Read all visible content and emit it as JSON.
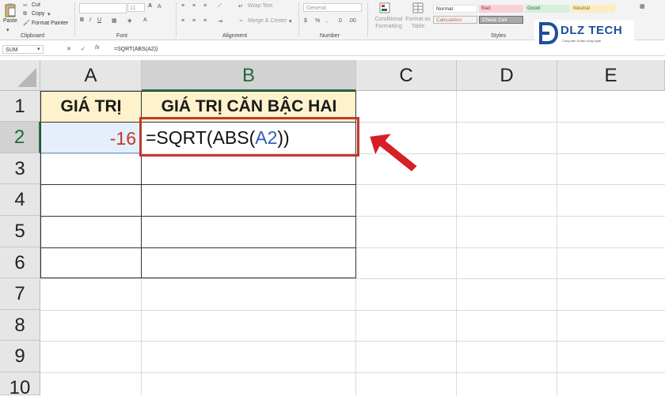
{
  "ribbon": {
    "clipboard": {
      "paste": "Paste",
      "cut": "Cut",
      "copy": "Copy",
      "format_painter": "Format Painter",
      "label": "Clipboard"
    },
    "font": {
      "label": "Font",
      "size": "11"
    },
    "alignment": {
      "wrap_text": "Wrap Text",
      "merge_center": "Merge & Center",
      "label": "Alignment"
    },
    "number": {
      "format": "General",
      "label": "Number"
    },
    "styles": {
      "conditional_formatting": "Conditional Formatting",
      "format_as_table": "Format as Table",
      "normal": "Normal",
      "bad": "Bad",
      "good": "Good",
      "neutral": "Neutral",
      "calculation": "Calculation",
      "check_cell": "Check Cell",
      "label": "Styles"
    }
  },
  "watermark": {
    "brand": "DLZ TECH",
    "tagline": "Cùng bạn đi đầu công nghệ"
  },
  "formula_bar": {
    "name_box": "SUM",
    "formula": "=SQRT(ABS(A2))",
    "cancel": "✕",
    "enter": "✓",
    "fx": "fx"
  },
  "columns": [
    "A",
    "B",
    "C",
    "D",
    "E"
  ],
  "rows": [
    "1",
    "2",
    "3",
    "4",
    "5",
    "6",
    "7",
    "8",
    "9",
    "10"
  ],
  "cells": {
    "a1": "GIÁ TRỊ",
    "b1": "GIÁ TRỊ CĂN BẬC HAI",
    "a2": "-16",
    "b2_prefix": "=SQRT(ABS(",
    "b2_ref": "A2",
    "b2_suffix": "))"
  },
  "colors": {
    "accent": "#217346",
    "ref_blue": "#2f5fb3",
    "ref_red": "#c0392b",
    "arrow": "#d61f26",
    "header_fill": "#fdf2cc",
    "ref_fill": "#e5eefb",
    "formula_border": "#c0392b"
  }
}
